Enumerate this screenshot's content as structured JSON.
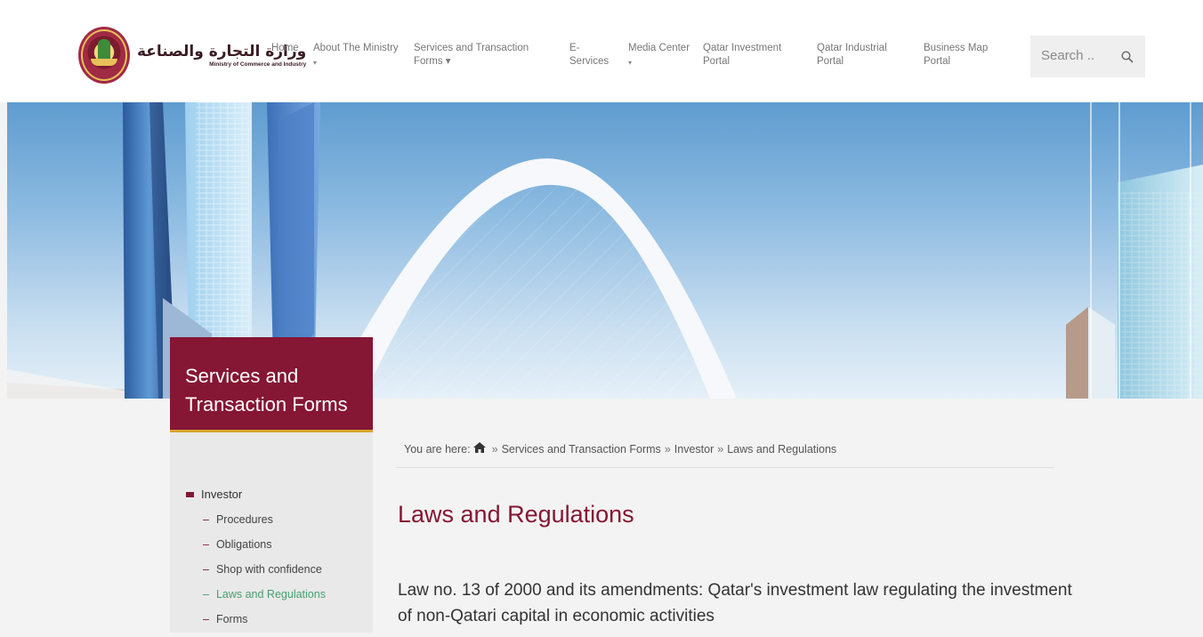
{
  "logo": {
    "arabic": "وزارة التجارة والصناعة",
    "english": "Ministry of Commerce and Industry"
  },
  "nav": [
    {
      "label": "Home",
      "caret": ""
    },
    {
      "label": "About The Ministry",
      "caret": "▾"
    },
    {
      "label": "Services and Transaction Forms ▾",
      "caret": ""
    },
    {
      "label": "E-Services",
      "caret": ""
    },
    {
      "label": "Media Center",
      "caret": "▾"
    },
    {
      "label": "Qatar Investment Portal",
      "caret": ""
    },
    {
      "label": "Qatar Industrial Portal",
      "caret": ""
    },
    {
      "label": "Business Map Portal",
      "caret": ""
    }
  ],
  "search": {
    "placeholder": "Search ..",
    "icon": "search-icon"
  },
  "sidebar": {
    "title_line1": "Services and",
    "title_line2": "Transaction Forms",
    "section": "Investor",
    "items": [
      {
        "label": "Procedures"
      },
      {
        "label": "Obligations"
      },
      {
        "label": "Shop with confidence"
      },
      {
        "label": "Laws and Regulations"
      },
      {
        "label": "Forms"
      }
    ],
    "active_item": "Laws and Regulations"
  },
  "breadcrumb": {
    "prefix": "You are here:",
    "home_icon": "home-icon",
    "separator": "»",
    "items": [
      "Services and Transaction Forms",
      "Investor",
      "Laws and Regulations"
    ]
  },
  "page": {
    "title": "Laws and Regulations",
    "body": "Law no. 13 of 2000 and its amendments: Qatar's investment law regulating the investment of non-Qatari capital in economic activities"
  },
  "colors": {
    "brand": "#851634",
    "accent_gold": "#d8a52c",
    "active_link": "#46a06c"
  }
}
